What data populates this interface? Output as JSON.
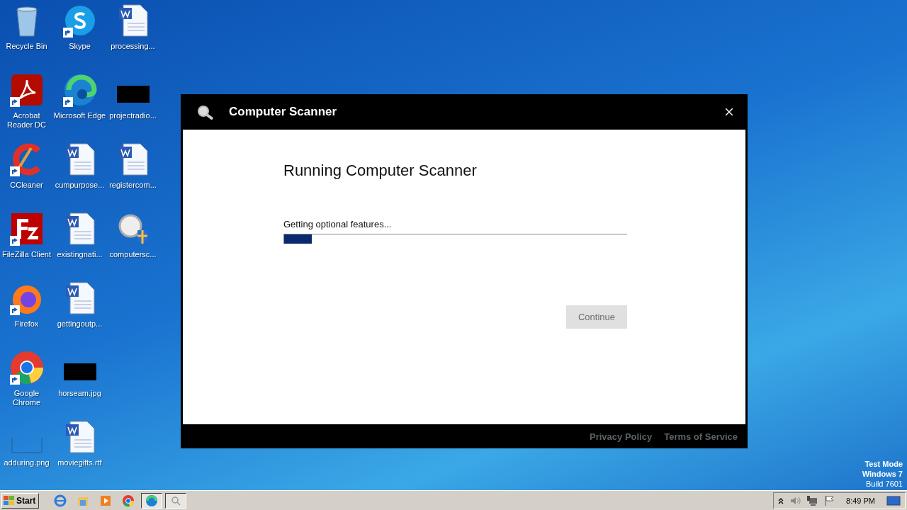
{
  "desktop": {
    "icons": [
      {
        "label": "Recycle Bin",
        "kind": "recycle",
        "shortcut": false
      },
      {
        "label": "Acrobat Reader DC",
        "kind": "acrobat",
        "shortcut": true
      },
      {
        "label": "CCleaner",
        "kind": "ccleaner",
        "shortcut": true
      },
      {
        "label": "FileZilla Client",
        "kind": "filezilla",
        "shortcut": true
      },
      {
        "label": "Firefox",
        "kind": "firefox",
        "shortcut": true
      },
      {
        "label": "Google Chrome",
        "kind": "chrome",
        "shortcut": true
      },
      {
        "label": "adduring.png",
        "kind": "blank",
        "shortcut": false
      },
      {
        "label": "Skype",
        "kind": "skype",
        "shortcut": true
      },
      {
        "label": "Microsoft Edge",
        "kind": "edge",
        "shortcut": true
      },
      {
        "label": "cumpurpose...",
        "kind": "word",
        "shortcut": false
      },
      {
        "label": "existingnati...",
        "kind": "word",
        "shortcut": false
      },
      {
        "label": "gettingoutp...",
        "kind": "word",
        "shortcut": false
      },
      {
        "label": "horseam.jpg",
        "kind": "black",
        "shortcut": false
      },
      {
        "label": "moviegifts.rtf",
        "kind": "word",
        "shortcut": false
      },
      {
        "label": "processing...",
        "kind": "word",
        "shortcut": false
      },
      {
        "label": "projectradio...",
        "kind": "black",
        "shortcut": false
      },
      {
        "label": "registercom...",
        "kind": "word",
        "shortcut": false
      },
      {
        "label": "computersc...",
        "kind": "scanner",
        "shortcut": false
      }
    ],
    "watermark_lines": [
      "Test Mode",
      "Windows 7",
      "Build 7601"
    ]
  },
  "dialog": {
    "title": "Computer Scanner",
    "heading": "Running Computer Scanner",
    "status": "Getting optional features...",
    "progress": {
      "level": 0.08
    },
    "continue_button": {
      "label": "Continue",
      "disabled": true
    },
    "footer_links": [
      "Privacy Policy",
      "Terms of Service"
    ]
  },
  "taskbar": {
    "start": "Start",
    "apps": [
      {
        "kind": "ie",
        "active": false
      },
      {
        "kind": "explorer",
        "active": false
      },
      {
        "kind": "media",
        "active": false
      },
      {
        "kind": "chrome",
        "active": false
      },
      {
        "kind": "edge",
        "active": true
      },
      {
        "kind": "scanner",
        "active": true
      }
    ],
    "clock": "8:49 PM"
  }
}
